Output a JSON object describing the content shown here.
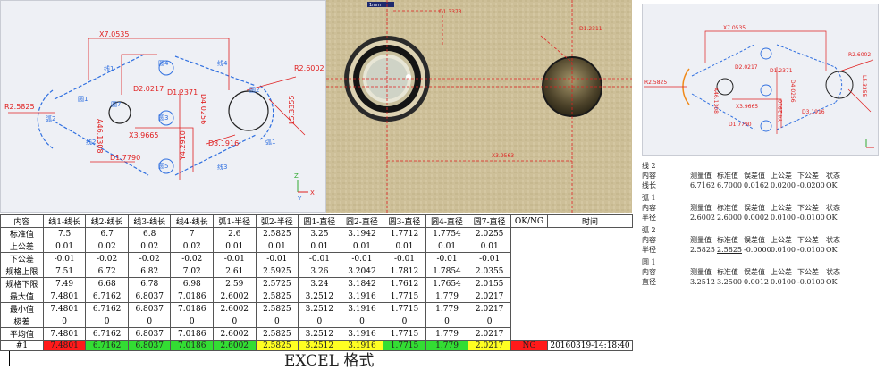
{
  "cad_main": {
    "labels": {
      "x_dim": "X7.0535",
      "r_left": "R2.5825",
      "r_right": "R2.6002",
      "l_right": "L5.3355",
      "d2": "D2.0217",
      "d1a": "D1.2371",
      "d4": "D4.0256",
      "a_dim": "A46.1308",
      "x3": "X3.9665",
      "y4": "Y4.2910",
      "d3": "D3.1916",
      "d1b": "D1.7790",
      "line1": "线1",
      "line2": "线2",
      "line3": "线3",
      "line4": "线4",
      "arc1": "弧1",
      "arc2": "弧2",
      "c1": "圆1",
      "c2": "圆2",
      "c3": "圆3",
      "c4": "圆4",
      "c5": "圆5",
      "c7": "圆7",
      "axis_z": "Z",
      "axis_x": "X",
      "axis_y": "Y"
    }
  },
  "photo": {
    "labels": {
      "d1": "D1.3373",
      "d2": "D1.2311",
      "x": "X3.9563",
      "ruler": "1mm"
    }
  },
  "cad_small": {
    "labels": {
      "x_dim": "X7.0535",
      "r_left": "R2.5825",
      "r_right": "R2.6002",
      "l_right": "L5.3355",
      "d2": "D2.0217",
      "d1a": "D1.2371",
      "a_dim": "A46.1308",
      "x3": "X3.9665",
      "y4": "Y4.2910",
      "d3": "D3.1916",
      "d1b": "D1.7790",
      "d4": "D4.0256"
    }
  },
  "table": {
    "headers": [
      "内容",
      "线1-线长",
      "线2-线长",
      "线3-线长",
      "线4-线长",
      "弧1-半径",
      "弧2-半径",
      "圆1-直径",
      "圆2-直径",
      "圆3-直径",
      "圆4-直径",
      "圆7-直径"
    ],
    "okng_header": "OK/NG",
    "time_header": "时间",
    "rows": [
      {
        "label": "标准值",
        "values": [
          "7.5",
          "6.7",
          "6.8",
          "7",
          "2.6",
          "2.5825",
          "3.25",
          "3.1942",
          "1.7712",
          "1.7754",
          "2.0255"
        ]
      },
      {
        "label": "上公差",
        "values": [
          "0.01",
          "0.02",
          "0.02",
          "0.02",
          "0.01",
          "0.01",
          "0.01",
          "0.01",
          "0.01",
          "0.01",
          "0.01"
        ]
      },
      {
        "label": "下公差",
        "values": [
          "-0.01",
          "-0.02",
          "-0.02",
          "-0.02",
          "-0.01",
          "-0.01",
          "-0.01",
          "-0.01",
          "-0.01",
          "-0.01",
          "-0.01"
        ]
      },
      {
        "label": "规格上限",
        "values": [
          "7.51",
          "6.72",
          "6.82",
          "7.02",
          "2.61",
          "2.5925",
          "3.26",
          "3.2042",
          "1.7812",
          "1.7854",
          "2.0355"
        ]
      },
      {
        "label": "规格下限",
        "values": [
          "7.49",
          "6.68",
          "6.78",
          "6.98",
          "2.59",
          "2.5725",
          "3.24",
          "3.1842",
          "1.7612",
          "1.7654",
          "2.0155"
        ]
      },
      {
        "label": "最大值",
        "values": [
          "7.4801",
          "6.7162",
          "6.8037",
          "7.0186",
          "2.6002",
          "2.5825",
          "3.2512",
          "3.1916",
          "1.7715",
          "1.779",
          "2.0217"
        ]
      },
      {
        "label": "最小值",
        "values": [
          "7.4801",
          "6.7162",
          "6.8037",
          "7.0186",
          "2.6002",
          "2.5825",
          "3.2512",
          "3.1916",
          "1.7715",
          "1.779",
          "2.0217"
        ]
      },
      {
        "label": "极差",
        "values": [
          "0",
          "0",
          "0",
          "0",
          "0",
          "0",
          "0",
          "0",
          "0",
          "0",
          "0"
        ]
      },
      {
        "label": "平均值",
        "values": [
          "7.4801",
          "6.7162",
          "6.8037",
          "7.0186",
          "2.6002",
          "2.5825",
          "3.2512",
          "3.1916",
          "1.7715",
          "1.779",
          "2.0217"
        ]
      }
    ],
    "result": {
      "label": "#1",
      "values": [
        "7.4801",
        "6.7162",
        "6.8037",
        "7.0186",
        "2.6002",
        "2.5825",
        "3.2512",
        "3.1916",
        "1.7715",
        "1.779",
        "2.0217"
      ],
      "states": [
        "red",
        "green",
        "green",
        "green",
        "green",
        "yellow",
        "yellow",
        "yellow",
        "green",
        "green",
        "yellow"
      ],
      "okng": "NG",
      "time": "20160319-14:18:40"
    }
  },
  "caption": "EXCEL 格式",
  "report": {
    "col_headers": [
      "内容",
      "测量值",
      "标准值",
      "误差值",
      "上公差",
      "下公差",
      "状态"
    ],
    "sections": [
      {
        "title": "线 2",
        "row": [
          "线长",
          "6.7162",
          "6.7000",
          "0.0162",
          "0.0200",
          "-0.0200",
          "OK"
        ]
      },
      {
        "title": "弧 1",
        "row": [
          "半径",
          "2.6002",
          "2.6000",
          "0.0002",
          "0.0100",
          "-0.0100",
          "OK"
        ]
      },
      {
        "title": "弧 2",
        "row": [
          "半径",
          "2.5825",
          "2.5825",
          "-0.0000",
          "0.0100",
          "-0.0100",
          "OK"
        ]
      },
      {
        "title": "圆 1",
        "row": [
          "直径",
          "3.2512",
          "3.2500",
          "0.0012",
          "0.0100",
          "-0.0100",
          "OK"
        ]
      }
    ]
  },
  "colors": {
    "red": "#ff1a1a",
    "green": "#33dd33",
    "yellow": "#ffff22",
    "dim": "#e02020",
    "feature": "#2f6fe0"
  }
}
